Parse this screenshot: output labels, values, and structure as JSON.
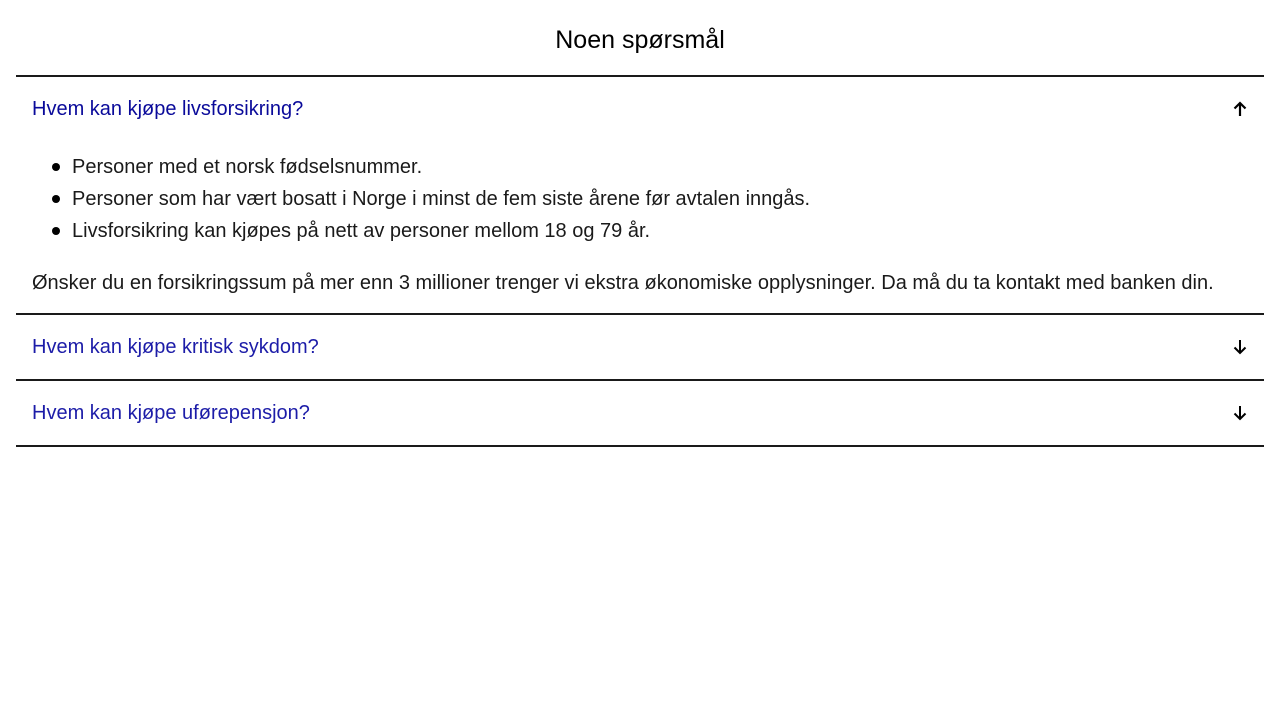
{
  "section": {
    "title": "Noen spørsmål"
  },
  "faq": [
    {
      "question": "Hvem kan kjøpe livsforsikring?",
      "expanded": true,
      "icon": "arrow-up-icon",
      "bullets": [
        "Personer med et norsk fødselsnummer.",
        "Personer som har vært bosatt i Norge i minst de fem siste årene før avtalen inngås.",
        "Livsforsikring kan kjøpes på nett av personer mellom 18 og 79 år."
      ],
      "paragraph": "Ønsker du en forsikringssum på mer enn 3 millioner trenger vi ekstra økonomiske opplysninger. Da må du ta kontakt med banken din."
    },
    {
      "question": "Hvem kan kjøpe kritisk sykdom?",
      "expanded": false,
      "icon": "arrow-down-icon"
    },
    {
      "question": "Hvem kan kjøpe uførepensjon?",
      "expanded": false,
      "icon": "arrow-down-icon"
    }
  ],
  "colors": {
    "question_link": "#1c1ca8",
    "divider": "#1a1a1a",
    "text": "#1a1a1a"
  }
}
